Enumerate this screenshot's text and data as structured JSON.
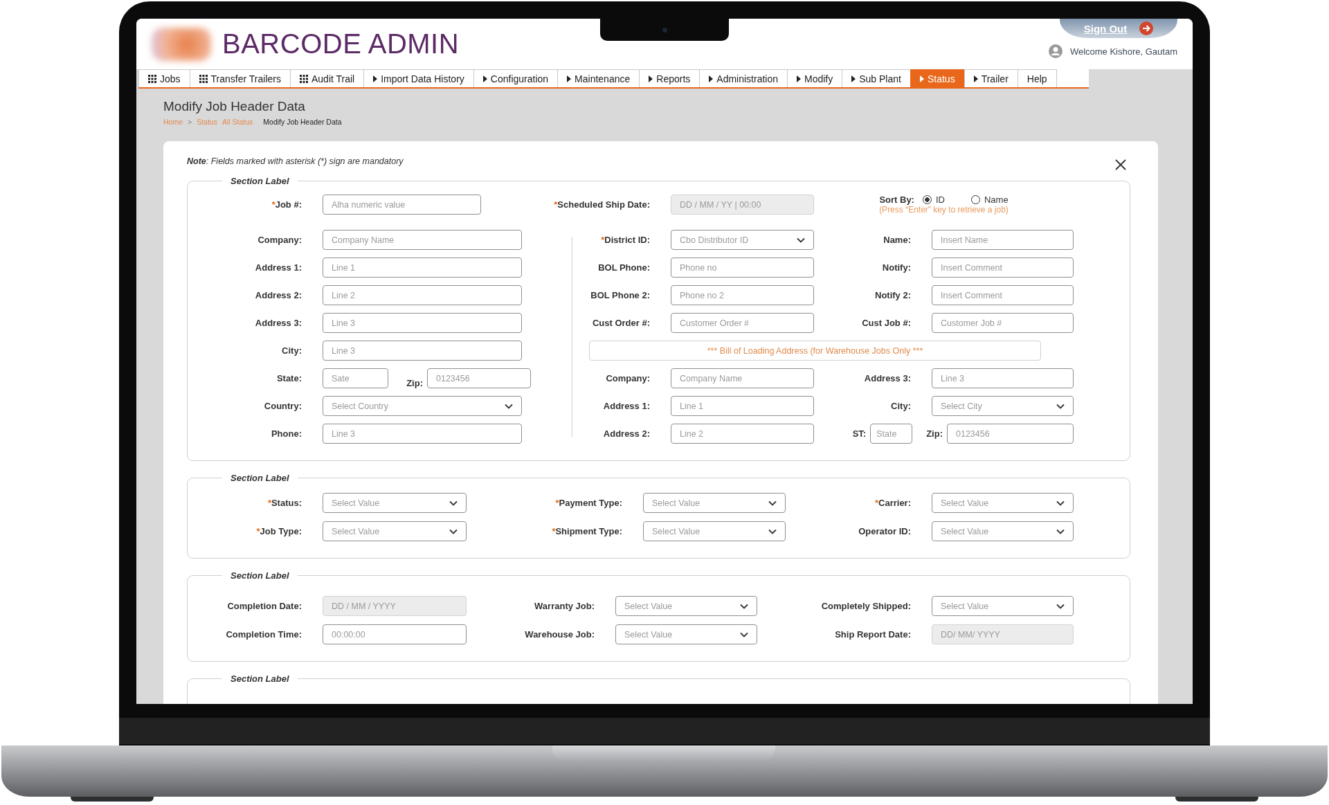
{
  "header": {
    "title": "BARCODE ADMIN",
    "sign_out": "Sign Out",
    "welcome": "Welcome Kishore, Gautam"
  },
  "nav": [
    {
      "label": "Jobs",
      "kind": "grid",
      "selected": false
    },
    {
      "label": "Transfer Trailers",
      "kind": "grid",
      "selected": false
    },
    {
      "label": "Audit Trail",
      "kind": "grid",
      "selected": false
    },
    {
      "label": "Import Data History",
      "kind": "caret",
      "selected": false
    },
    {
      "label": "Configuration",
      "kind": "caret",
      "selected": false
    },
    {
      "label": "Maintenance",
      "kind": "caret",
      "selected": false
    },
    {
      "label": "Reports",
      "kind": "caret",
      "selected": false
    },
    {
      "label": "Administration",
      "kind": "caret",
      "selected": false
    },
    {
      "label": "Modify",
      "kind": "caret",
      "selected": false
    },
    {
      "label": "Sub Plant",
      "kind": "caret",
      "selected": false
    },
    {
      "label": "Status",
      "kind": "caret",
      "selected": true
    },
    {
      "label": "Trailer",
      "kind": "caret",
      "selected": false
    },
    {
      "label": "Help",
      "kind": "plain",
      "selected": false
    }
  ],
  "page_title": "Modify Job Header Data",
  "breadcrumb": [
    {
      "label": "Home",
      "kind": "link"
    },
    {
      "label": ">",
      "kind": "separator"
    },
    {
      "label": "Status",
      "kind": "link"
    },
    {
      "label": "All Status",
      "kind": "link"
    },
    {
      "label": "Modify Job Header Data",
      "kind": "current"
    }
  ],
  "form": {
    "note": "**Note**: Fields marked with asterisk (*) sign are mandatory",
    "sections": [
      {
        "kind": "address",
        "legend": "Section Label",
        "top": [
          {
            "label": "Job #:",
            "required_mark": "*",
            "kind": "input",
            "placeholder": "Alha numeric value",
            "disabled": false
          },
          {
            "label": "Scheduled Ship Date:",
            "required_mark": "*",
            "kind": "input",
            "placeholder": "DD / MM / YY | 00:00",
            "disabled": true
          }
        ],
        "sort_by": {
          "label": "Sort By:",
          "options": [
            {
              "label": "ID",
              "selected": true
            },
            {
              "label": "Name",
              "selected": false
            }
          ],
          "hint": "(Press “Enter” key to retrieve a job)"
        },
        "left": [
          {
            "label": "Company:",
            "kind": "input",
            "placeholder": "Company Name",
            "disabled": false
          },
          {
            "label": "Address 1:",
            "kind": "input",
            "placeholder": "Line 1",
            "disabled": false
          },
          {
            "label": "Address 2:",
            "kind": "input",
            "placeholder": "Line 2",
            "disabled": false
          },
          {
            "label": "Address 3:",
            "kind": "input",
            "placeholder": "Line 3",
            "disabled": false
          },
          {
            "label": "City:",
            "kind": "input",
            "placeholder": "Line 3",
            "disabled": false
          },
          {
            "label": "State:",
            "kind": "pair",
            "placeholder": "Sate",
            "second_label": "Zip:",
            "second_placeholder": "0123456"
          },
          {
            "label": "Country:",
            "kind": "select",
            "placeholder": "Select Country"
          },
          {
            "label": "Phone:",
            "kind": "input",
            "placeholder": "Line 3",
            "disabled": false
          }
        ],
        "right": [
          {
            "kind": "fields",
            "cells": [
              {
                "label": "District ID:",
                "required_mark": "*",
                "kind": "select",
                "placeholder": "Cbo Distributor ID"
              },
              {
                "label": "Name:",
                "kind": "input",
                "placeholder": "Insert Name",
                "disabled": false
              }
            ]
          },
          {
            "kind": "fields",
            "cells": [
              {
                "label": "BOL Phone:",
                "kind": "input",
                "placeholder": "Phone no",
                "disabled": false
              },
              {
                "label": "Notify:",
                "kind": "input",
                "placeholder": "Insert Comment",
                "disabled": false
              }
            ]
          },
          {
            "kind": "fields",
            "cells": [
              {
                "label": "BOL Phone 2:",
                "kind": "input",
                "placeholder": "Phone no 2",
                "disabled": false
              },
              {
                "label": "Notify 2:",
                "kind": "input",
                "placeholder": "Insert Comment",
                "disabled": false
              }
            ]
          },
          {
            "kind": "fields",
            "cells": [
              {
                "label": "Cust Order #:",
                "kind": "input",
                "placeholder": "Customer Order #",
                "disabled": false
              },
              {
                "label": "Cust Job #:",
                "kind": "input",
                "placeholder": "Customer Job #",
                "disabled": false
              }
            ]
          },
          {
            "kind": "banner",
            "text": "*** Bill of Loading Address (for Warehouse Jobs Only ***"
          },
          {
            "kind": "fields",
            "cells": [
              {
                "label": "Company:",
                "kind": "input",
                "placeholder": "Company Name",
                "disabled": false
              },
              {
                "label": "Address 3:",
                "kind": "input",
                "placeholder": "Line 3",
                "disabled": false
              }
            ]
          },
          {
            "kind": "fields",
            "cells": [
              {
                "label": "Address 1:",
                "kind": "input",
                "placeholder": "Line 1",
                "disabled": false
              },
              {
                "label": "City:",
                "kind": "select",
                "placeholder": "Select City"
              }
            ]
          },
          {
            "kind": "fields",
            "cells": [
              {
                "label": "Address 2:",
                "kind": "input",
                "placeholder": "Line 2",
                "disabled": false
              },
              {
                "label": "ST:",
                "kind": "pair",
                "placeholder": "State",
                "second_label": "Zip:",
                "second_placeholder": "0123456"
              }
            ]
          }
        ]
      },
      {
        "kind": "grid",
        "legend": "Section Label",
        "rows": [
          [
            {
              "label": "Status:",
              "required_mark": "*",
              "kind": "select",
              "placeholder": "Select Value"
            },
            {
              "label": "Payment Type:",
              "required_mark": "*",
              "kind": "select",
              "placeholder": "Select Value"
            },
            {
              "label": "Carrier:",
              "required_mark": "*",
              "kind": "select",
              "placeholder": "Select Value"
            }
          ],
          [
            {
              "label": "Job Type:",
              "required_mark": "*",
              "kind": "select",
              "placeholder": "Select Value"
            },
            {
              "label": "Shipment Type:",
              "required_mark": "*",
              "kind": "select",
              "placeholder": "Select Value"
            },
            {
              "label": "Operator ID:",
              "kind": "select",
              "placeholder": "Select Value"
            }
          ]
        ]
      },
      {
        "kind": "grid",
        "legend": "Section Label",
        "rows": [
          [
            {
              "label": "Completion Date:",
              "kind": "input",
              "placeholder": "DD / MM / YYYY",
              "disabled": true
            },
            {
              "label": "Warranty Job:",
              "kind": "select",
              "placeholder": "Select Value"
            },
            {
              "label": "Completely Shipped:",
              "kind": "select",
              "placeholder": "Select Value"
            }
          ],
          [
            {
              "label": "Completion Time:",
              "kind": "input",
              "placeholder": "00:00:00",
              "disabled": false
            },
            {
              "label": "Warehouse Job:",
              "kind": "select",
              "placeholder": "Select Value"
            },
            {
              "label": "Ship Report Date:",
              "kind": "input",
              "placeholder": "DD/ MM/ YYYY",
              "disabled": true
            }
          ]
        ]
      },
      {
        "kind": "empty",
        "legend": "Section Label"
      }
    ]
  }
}
